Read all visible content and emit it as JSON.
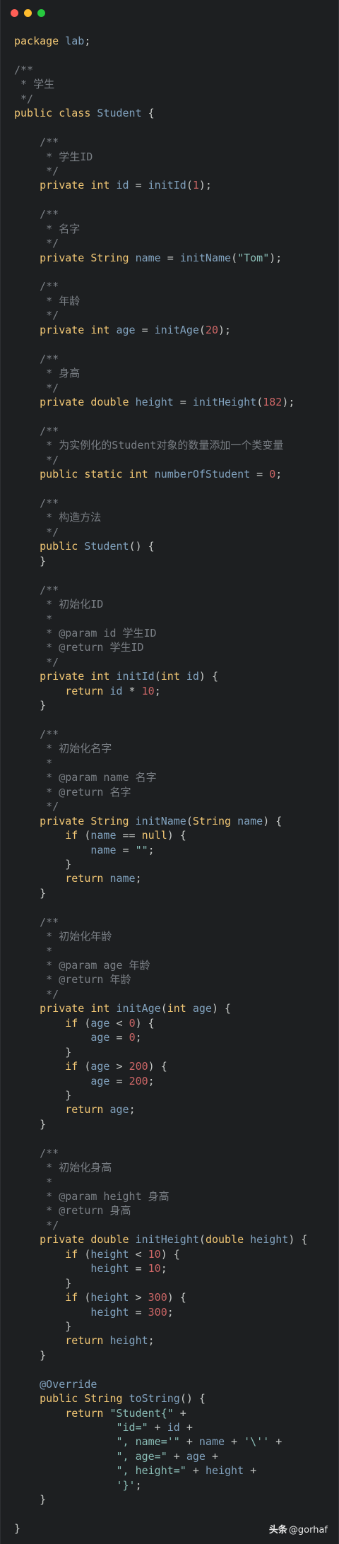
{
  "window": {
    "controls": [
      {
        "name": "close",
        "color": "#ff5f56"
      },
      {
        "name": "minimize",
        "color": "#ffbd2e"
      },
      {
        "name": "maximize",
        "color": "#27c93f"
      }
    ]
  },
  "watermark": {
    "brand": "头条",
    "handle": "@gorhaf"
  },
  "code_lines": [
    "package lab;",
    "",
    "/**",
    " * 学生",
    " */",
    "public class Student {",
    "",
    "    /**",
    "     * 学生ID",
    "     */",
    "    private int id = initId(1);",
    "",
    "    /**",
    "     * 名字",
    "     */",
    "    private String name = initName(\"Tom\");",
    "",
    "    /**",
    "     * 年龄",
    "     */",
    "    private int age = initAge(20);",
    "",
    "    /**",
    "     * 身高",
    "     */",
    "    private double height = initHeight(182);",
    "",
    "    /**",
    "     * 为实例化的Student对象的数量添加一个类变量",
    "     */",
    "    public static int numberOfStudent = 0;",
    "",
    "    /**",
    "     * 构造方法",
    "     */",
    "    public Student() {",
    "    }",
    "",
    "    /**",
    "     * 初始化ID",
    "     *",
    "     * @param id 学生ID",
    "     * @return 学生ID",
    "     */",
    "    private int initId(int id) {",
    "        return id * 10;",
    "    }",
    "",
    "    /**",
    "     * 初始化名字",
    "     *",
    "     * @param name 名字",
    "     * @return 名字",
    "     */",
    "    private String initName(String name) {",
    "        if (name == null) {",
    "            name = \"\";",
    "        }",
    "        return name;",
    "    }",
    "",
    "    /**",
    "     * 初始化年龄",
    "     *",
    "     * @param age 年龄",
    "     * @return 年龄",
    "     */",
    "    private int initAge(int age) {",
    "        if (age < 0) {",
    "            age = 0;",
    "        }",
    "        if (age > 200) {",
    "            age = 200;",
    "        }",
    "        return age;",
    "    }",
    "",
    "    /**",
    "     * 初始化身高",
    "     *",
    "     * @param height 身高",
    "     * @return 身高",
    "     */",
    "    private double initHeight(double height) {",
    "        if (height < 10) {",
    "            height = 10;",
    "        }",
    "        if (height > 300) {",
    "            height = 300;",
    "        }",
    "        return height;",
    "    }",
    "",
    "    @Override",
    "    public String toString() {",
    "        return \"Student{\" +",
    "                \"id=\" + id +",
    "                \", name='\" + name + '\\'' +",
    "                \", age=\" + age +",
    "                \", height=\" + height +",
    "                '}';",
    "    }",
    "",
    "}"
  ]
}
